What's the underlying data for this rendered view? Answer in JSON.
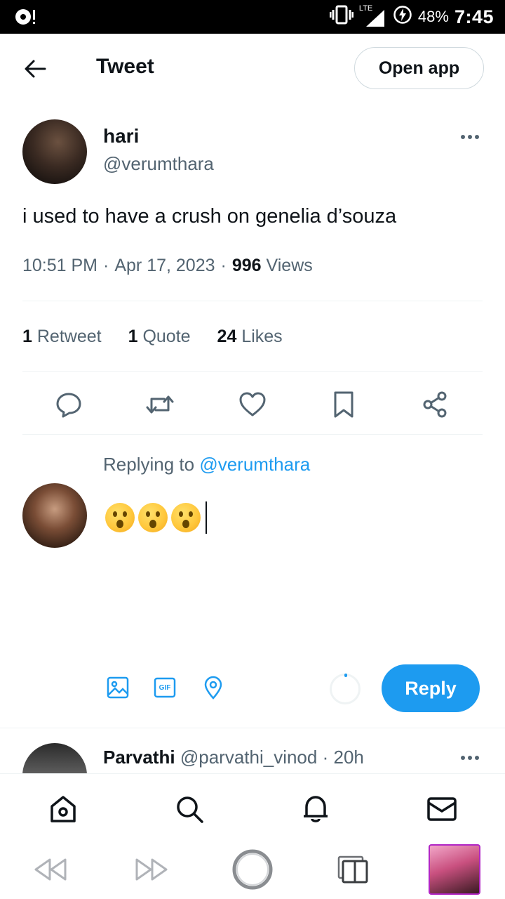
{
  "status_bar": {
    "network": "LTE",
    "battery_percent": "48%",
    "time": "7:45"
  },
  "header": {
    "title": "Tweet",
    "open_app_label": "Open app"
  },
  "tweet": {
    "author_name": "hari",
    "author_handle": "@verumthara",
    "text": "i used to have a crush on genelia d’souza",
    "time": "10:51 PM",
    "sep1": "·",
    "date": "Apr 17, 2023",
    "sep2": "·",
    "views_count": "996",
    "views_label": "Views",
    "stats": {
      "retweets_count": "1",
      "retweets_label": "Retweet",
      "quotes_count": "1",
      "quotes_label": "Quote",
      "likes_count": "24",
      "likes_label": "Likes"
    }
  },
  "composer": {
    "replying_prefix": "Replying to",
    "replying_handle": "@verumthara",
    "emoji_count": 3,
    "reply_label": "Reply",
    "gif_label": "GIF"
  },
  "next_reply": {
    "name": "Parvathi",
    "handle": "@parvathi_vinod",
    "sep": "·",
    "age": "20h"
  },
  "icons": {
    "back": "arrow-left-icon",
    "more": "more-horizontal-icon",
    "reply": "comment-icon",
    "retweet": "retweet-icon",
    "like": "heart-icon",
    "bookmark": "bookmark-icon",
    "share": "share-icon",
    "image": "image-icon",
    "gif": "gif-icon",
    "location": "location-pin-icon",
    "home": "home-icon",
    "search": "search-icon",
    "notifications": "bell-icon",
    "messages": "mail-icon"
  },
  "colors": {
    "accent": "#1d9bf0",
    "text_primary": "#0f1419",
    "text_secondary": "#536471",
    "divider": "#eff3f4"
  }
}
